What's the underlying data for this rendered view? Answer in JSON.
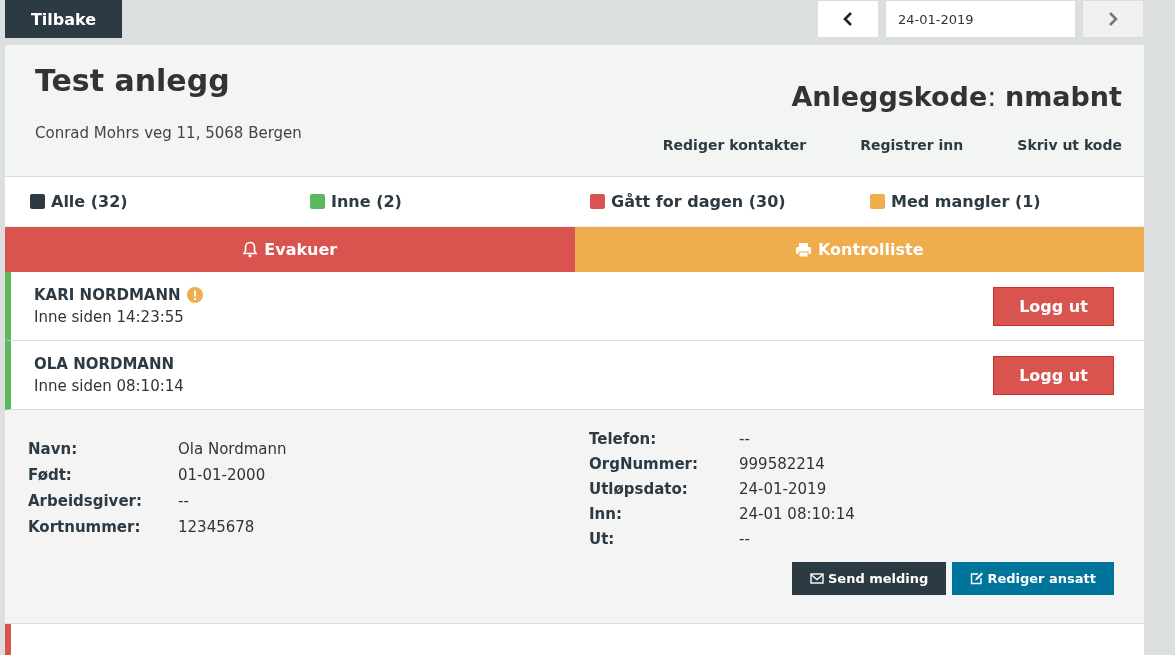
{
  "topbar": {
    "back": "Tilbake",
    "date": "24-01-2019",
    "prev": {
      "disabled": false
    },
    "next": {
      "disabled": true
    }
  },
  "header": {
    "title": "Test anlegg",
    "address": "Conrad Mohrs veg 11, 5068 Bergen",
    "code_label": "Anleggskode",
    "code_separator": ":",
    "code": "nmabnt",
    "links": [
      "Rediger kontakter",
      "Registrer inn",
      "Skriv ut kode"
    ]
  },
  "filters": [
    {
      "label": "Alle (32)",
      "color": "#2c3a44"
    },
    {
      "label": "Inne (2)",
      "color": "#5cb85c"
    },
    {
      "label": "Gått for dagen (30)",
      "color": "#d9534f"
    },
    {
      "label": "Med mangler (1)",
      "color": "#f0ad4e"
    }
  ],
  "actions": [
    {
      "kind": "evacuate",
      "label": "Evakuer"
    },
    {
      "kind": "print",
      "label": "Kontrolliste"
    }
  ],
  "people": [
    {
      "name": "KARI NORDMANN",
      "status": "Inne siden 14:23:55",
      "color": "#5cb85c",
      "warning": true,
      "expanded": false,
      "button": "Logg ut"
    },
    {
      "name": "OLA NORDMANN",
      "status": "Inne siden 08:10:14",
      "color": "#5cb85c",
      "warning": false,
      "expanded": true,
      "button": "Logg ut",
      "details_left": [
        {
          "label": "Navn:",
          "value": "Ola Nordmann"
        },
        {
          "label": "Født:",
          "value": "01-01-2000"
        },
        {
          "label": "Arbeidsgiver:",
          "value": "--"
        },
        {
          "label": "Kortnummer:",
          "value": "12345678"
        }
      ],
      "details_right": [
        {
          "label": "Telefon:",
          "value": "--"
        },
        {
          "label": "OrgNummer:",
          "value": "999582214"
        },
        {
          "label": "Utløpsdato:",
          "value": "24-01-2019"
        },
        {
          "label": "Inn:",
          "value": "24-01 08:10:14"
        },
        {
          "label": "Ut:",
          "value": "--"
        }
      ],
      "detail_buttons": [
        {
          "kind": "message",
          "label": "Send melding"
        },
        {
          "kind": "edit",
          "label": "Rediger ansatt"
        }
      ]
    }
  ],
  "next_row": {
    "color": "#d9534f"
  }
}
